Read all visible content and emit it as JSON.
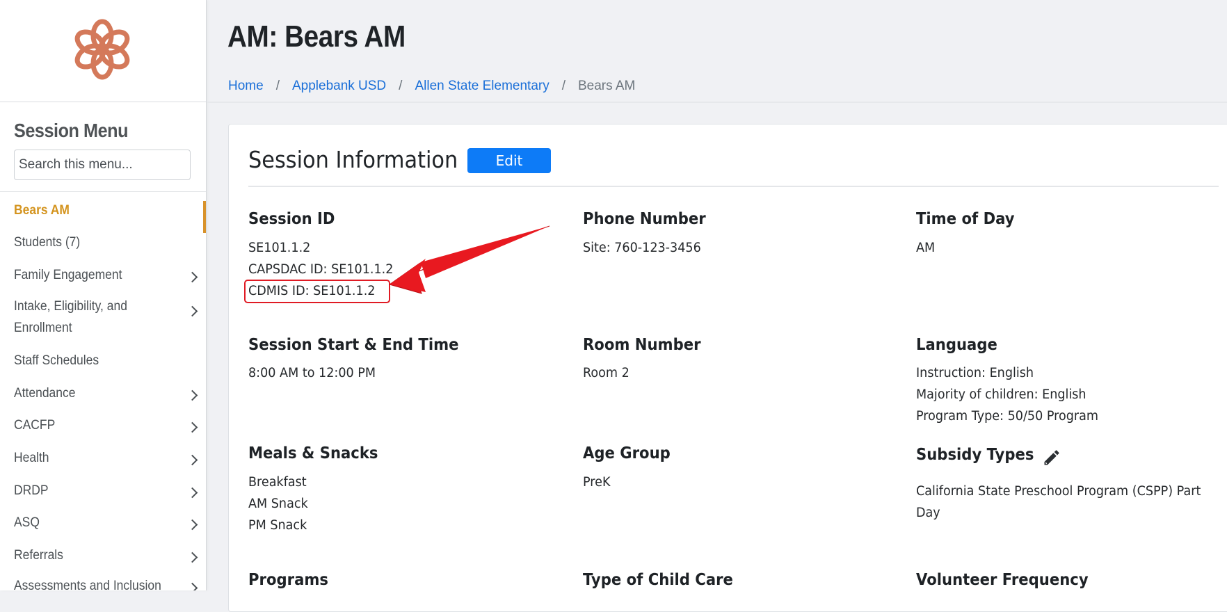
{
  "sidebar": {
    "menu_title": "Session Menu",
    "search_placeholder": "Search this menu...",
    "items": [
      {
        "label": "Bears AM",
        "active": true,
        "chevron": false
      },
      {
        "label": "Students (7)",
        "chevron": false
      },
      {
        "label": "Family Engagement",
        "chevron": true
      },
      {
        "label": "Intake, Eligibility, and",
        "label2": "Enrollment",
        "chevron": true
      },
      {
        "label": "Staff Schedules",
        "chevron": false
      },
      {
        "label": "Attendance",
        "chevron": true
      },
      {
        "label": "CACFP",
        "chevron": true
      },
      {
        "label": "Health",
        "chevron": true
      },
      {
        "label": "DRDP",
        "chevron": true
      },
      {
        "label": "ASQ",
        "chevron": true
      },
      {
        "label": "Referrals",
        "chevron": true
      },
      {
        "label": "Assessments and Inclusion",
        "chevron": true
      }
    ]
  },
  "header": {
    "title": "AM: Bears AM",
    "breadcrumb": [
      "Home",
      "Applebank USD",
      "Allen State Elementary",
      "Bears AM"
    ]
  },
  "card": {
    "title": "Session Information",
    "edit_label": "Edit"
  },
  "fields": {
    "session_id": {
      "label": "Session ID",
      "values": [
        "SE101.1.2",
        "CAPSDAC ID:  SE101.1.2",
        "CDMIS ID:  SE101.1.2"
      ]
    },
    "phone": {
      "label": "Phone Number",
      "values": [
        "Site: 760-123-3456"
      ]
    },
    "time_of_day": {
      "label": "Time of Day",
      "values": [
        "AM"
      ]
    },
    "start_end": {
      "label": "Session Start & End Time",
      "values": [
        "8:00 AM to 12:00 PM"
      ]
    },
    "room": {
      "label": "Room Number",
      "values": [
        "Room 2"
      ]
    },
    "language": {
      "label": "Language",
      "values": [
        "Instruction: English",
        "Majority of children: English",
        "Program Type: 50/50 Program"
      ]
    },
    "meals": {
      "label": "Meals & Snacks",
      "values": [
        "Breakfast",
        "AM Snack",
        "PM Snack"
      ]
    },
    "age_group": {
      "label": "Age Group",
      "values": [
        "PreK"
      ]
    },
    "subsidy": {
      "label": "Subsidy Types",
      "values": [
        "California State Preschool Program (CSPP) Part",
        "Day"
      ]
    },
    "programs": {
      "label": "Programs"
    },
    "child_care": {
      "label": "Type of Child Care"
    },
    "volunteer": {
      "label": "Volunteer Frequency"
    }
  },
  "colors": {
    "accent": "#0d7bf7",
    "active_menu": "#d4941f",
    "annotation": "#e01b24",
    "logo": "#d4795a"
  },
  "icons": {
    "logo": "flower-logo-icon",
    "pencil": "pencil-icon",
    "chevron": "chevron-right-icon"
  }
}
